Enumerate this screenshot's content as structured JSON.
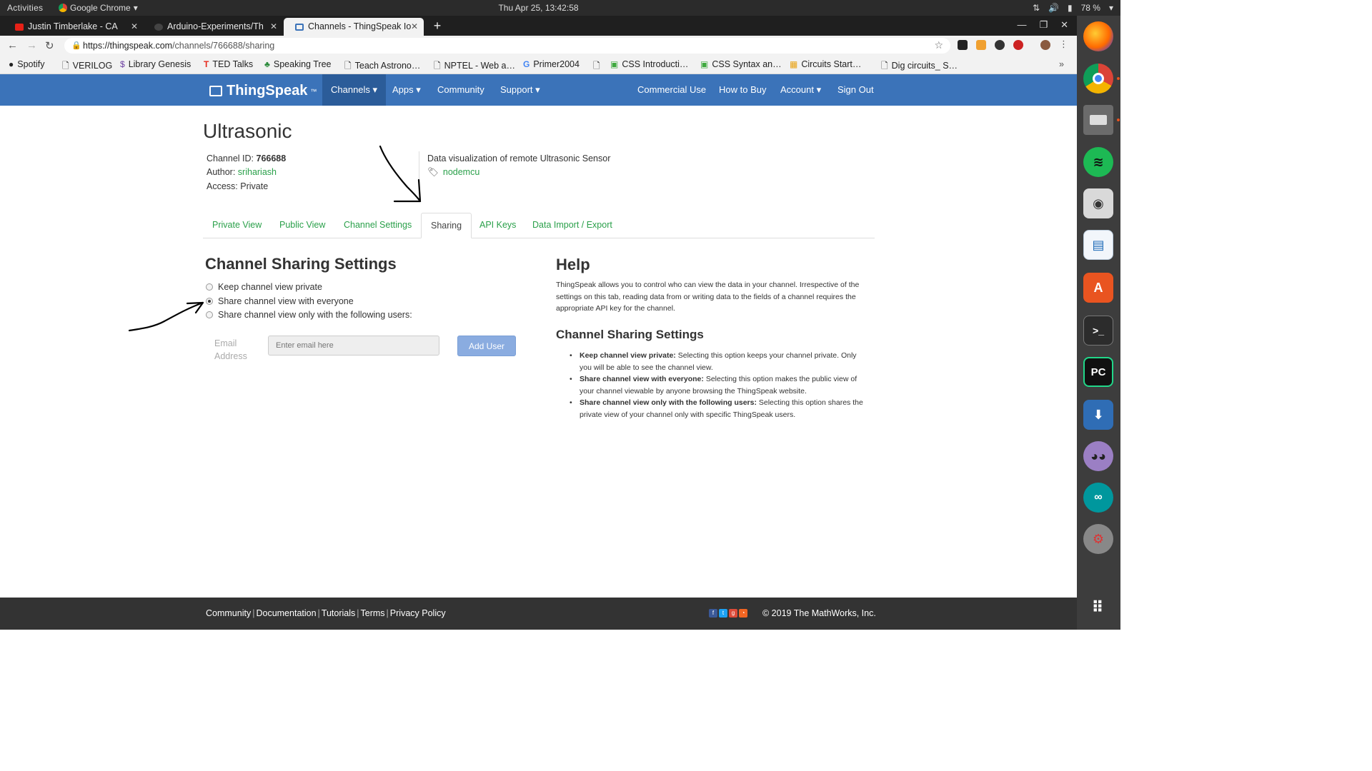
{
  "topbar": {
    "activities": "Activities",
    "app": "Google Chrome",
    "clock": "Thu Apr 25, 13:42:58",
    "battery": "78 %"
  },
  "browser": {
    "tabs": [
      {
        "title": "Justin Timberlake - CA",
        "favicon_color": "#e62117"
      },
      {
        "title": "Arduino-Experiments/Th",
        "favicon_color": "#444444"
      },
      {
        "title": "Channels - ThingSpeak Io",
        "favicon_color": "#3b73b9",
        "active": true
      }
    ],
    "url_host": "https://thingspeak.com",
    "url_path": "/channels/766688/sharing"
  },
  "bookmarks": [
    "Spotify",
    "VERILOG",
    "Library Genesis",
    "TED Talks",
    "Speaking Tree",
    "Teach Astrono…",
    "NPTEL - Web a…",
    "Primer2004",
    "",
    "CSS Introducti…",
    "CSS Syntax an…",
    "Circuits Start…",
    "Dig circuits_ S…"
  ],
  "site_nav": {
    "logo": "ThingSpeak",
    "logo_tm": "™",
    "left": [
      "Channels ▾",
      "Apps ▾",
      "Community",
      "Support ▾"
    ],
    "right": [
      "Commercial Use",
      "How to Buy",
      "Account ▾",
      "Sign Out"
    ],
    "brand_color": "#3b73b9"
  },
  "channel": {
    "name": "Ultrasonic",
    "id_label": "Channel ID:",
    "id": "766688",
    "author_label": "Author:",
    "author": "srihariash",
    "access_label": "Access:",
    "access": "Private",
    "description": "Data visualization of remote Ultrasonic Sensor",
    "tag": "nodemcu"
  },
  "page_tabs": [
    "Private View",
    "Public View",
    "Channel Settings",
    "Sharing",
    "API Keys",
    "Data Import / Export"
  ],
  "sharing": {
    "heading": "Channel Sharing Settings",
    "options": [
      {
        "label": "Keep channel view private",
        "selected": false
      },
      {
        "label": "Share channel view with everyone",
        "selected": true
      },
      {
        "label": "Share channel view only with the following users:",
        "selected": false
      }
    ],
    "email_label": "Email Address",
    "email_placeholder": "Enter email here",
    "add_button": "Add User"
  },
  "help": {
    "heading": "Help",
    "intro": "ThingSpeak allows you to control who can view the data in your channel. Irrespective of the settings on this tab, reading data from or writing data to the fields of a channel requires the appropriate API key for the channel.",
    "subheading": "Channel Sharing Settings",
    "items": [
      {
        "term": "Keep channel view private:",
        "text": " Selecting this option keeps your channel private. Only you will be able to see the channel view."
      },
      {
        "term": "Share channel view with everyone:",
        "text": " Selecting this option makes the public view of your channel viewable by anyone browsing the ThingSpeak website."
      },
      {
        "term": "Share channel view only with the following users:",
        "text": " Selecting this option shares the private view of your channel only with specific ThingSpeak users."
      }
    ]
  },
  "footer": {
    "links": [
      "Community",
      "Documentation",
      "Tutorials",
      "Terms",
      "Privacy Policy"
    ],
    "copyright": "© 2019 The MathWorks, Inc."
  },
  "dock_icons": [
    "firefox-icon",
    "chrome-icon",
    "files-icon",
    "spotify-icon",
    "rhythmbox-icon",
    "writer-icon",
    "software-center-icon",
    "terminal-icon",
    "pycharm-icon",
    "installer-icon",
    "pidgin-icon",
    "arduino-icon",
    "settings-icon",
    "app-grid-icon"
  ]
}
